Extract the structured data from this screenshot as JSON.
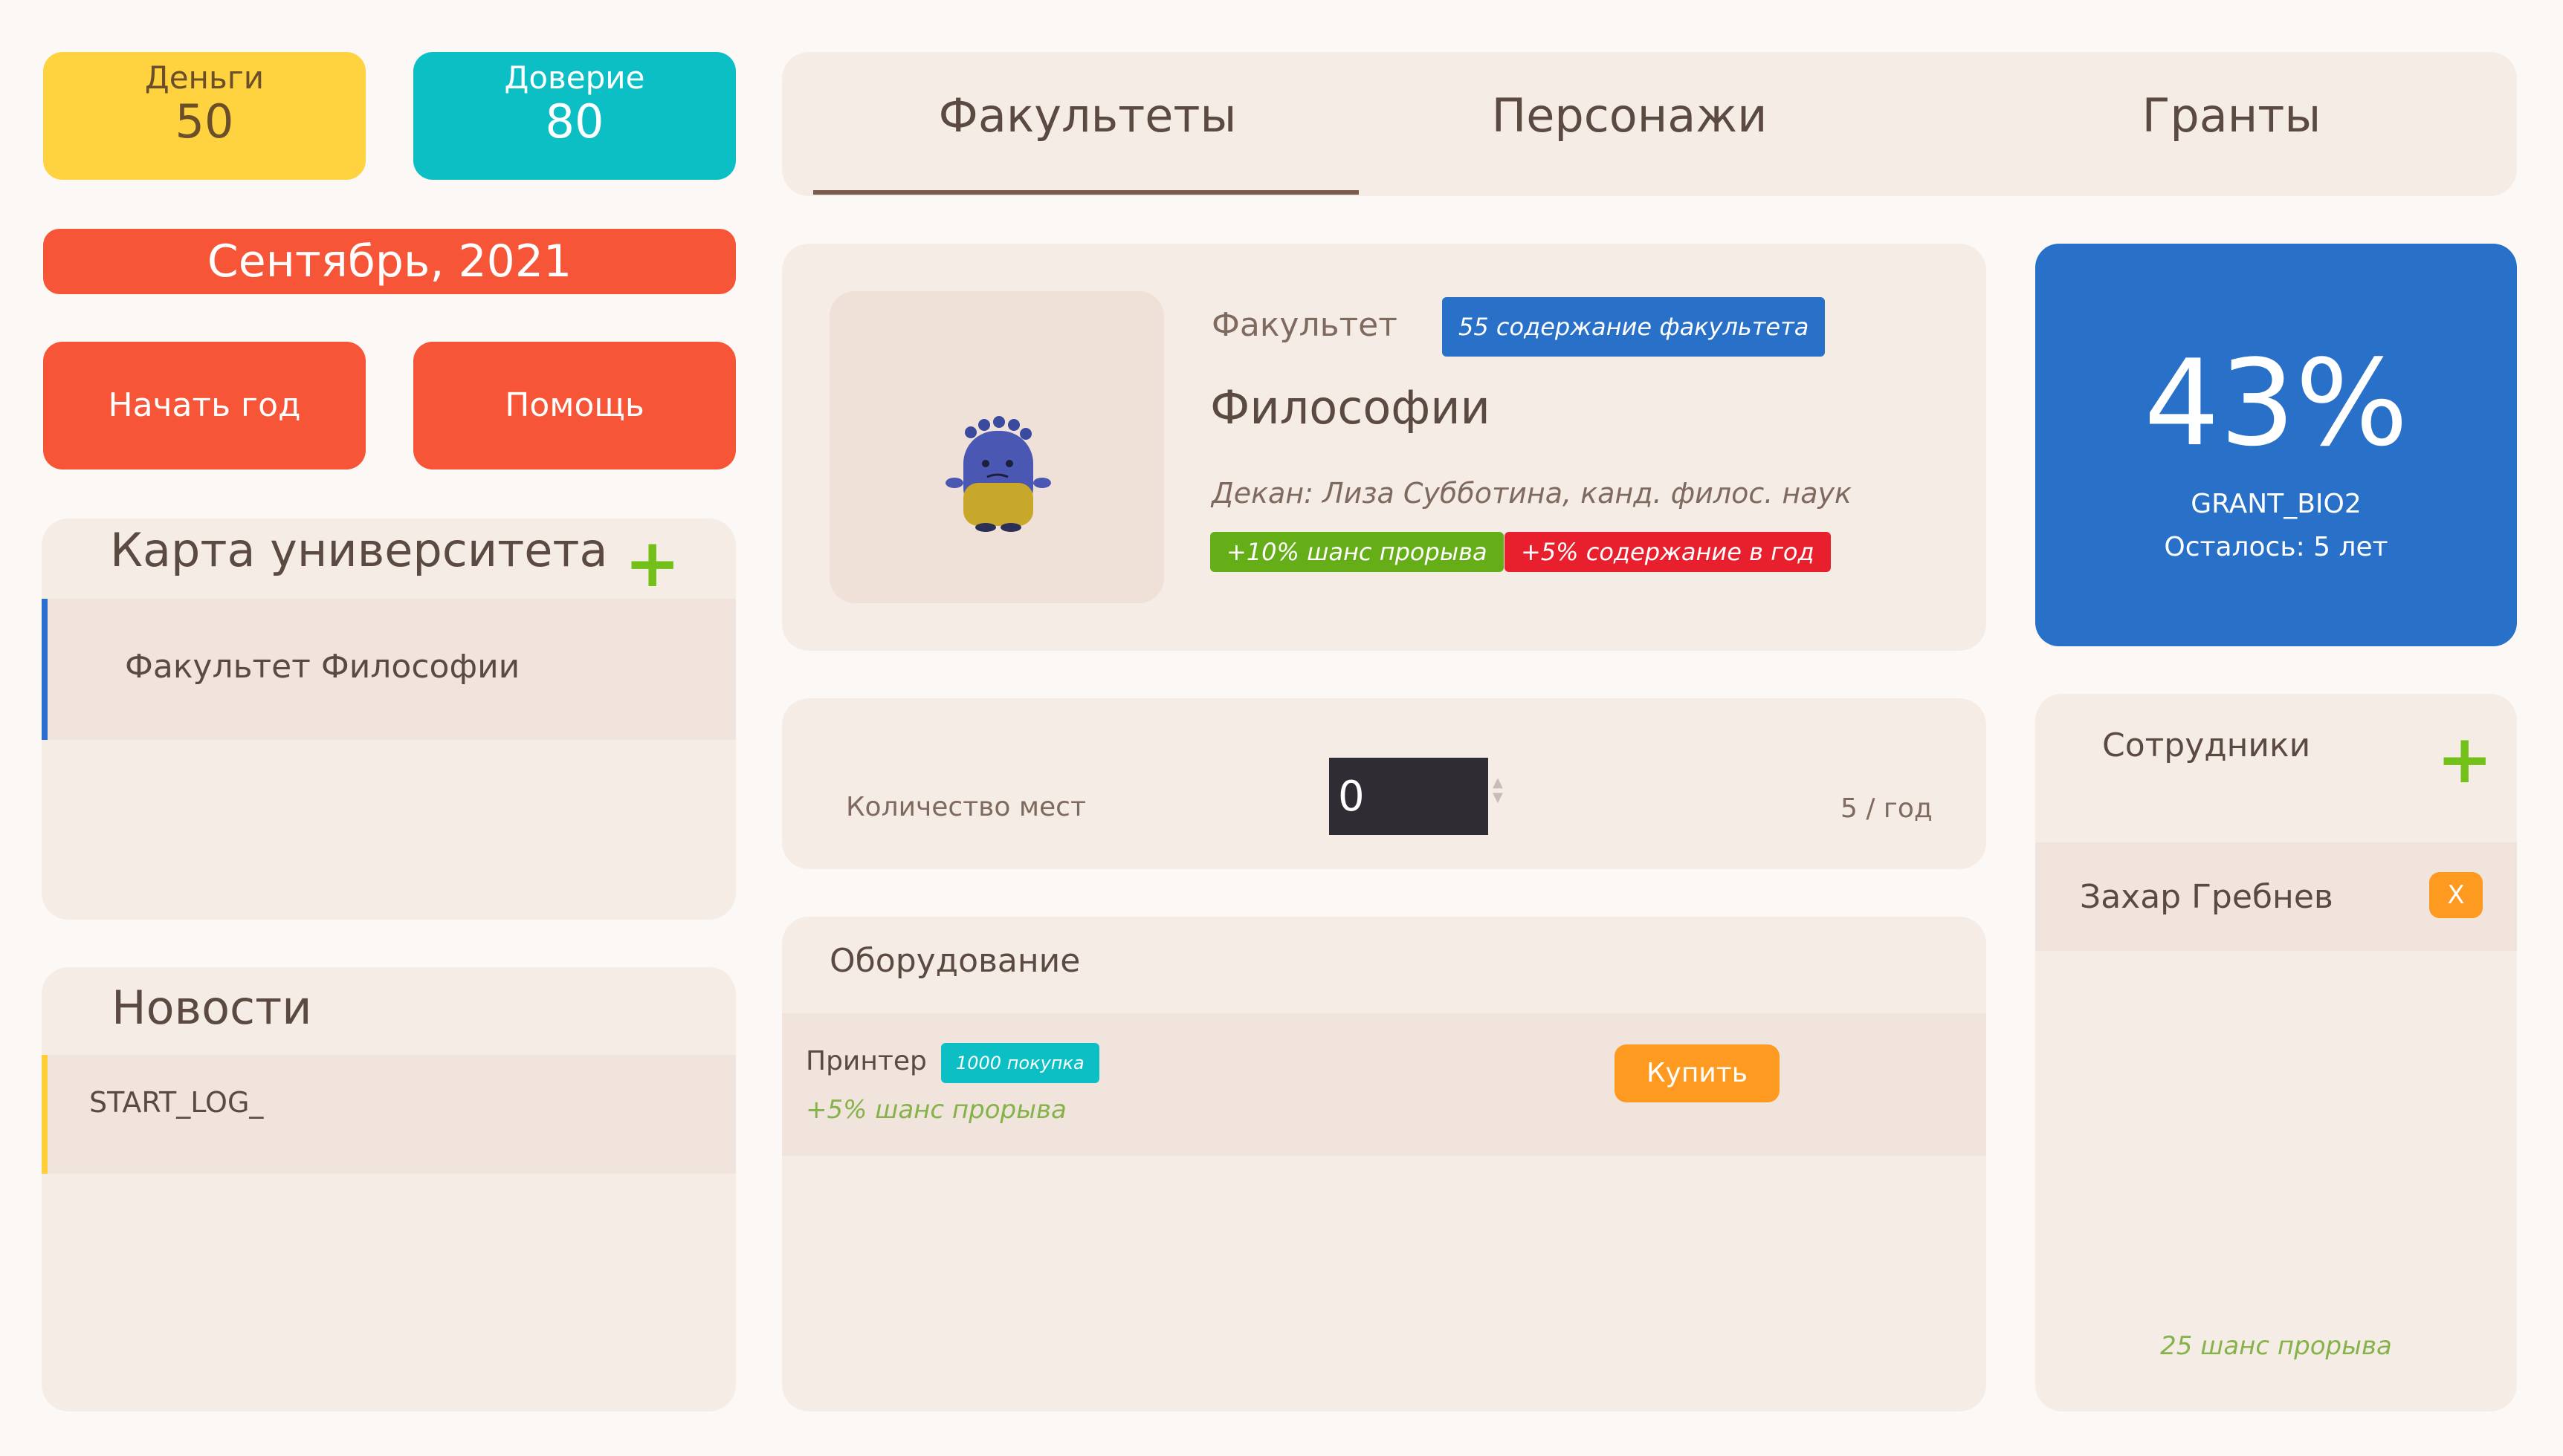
{
  "stats": {
    "money": {
      "label": "Деньги",
      "value": "50"
    },
    "trust": {
      "label": "Доверие",
      "value": "80"
    }
  },
  "date": "Сентябрь, 2021",
  "actions": {
    "start_year": "Начать год",
    "help": "Помощь"
  },
  "map": {
    "title": "Карта университета",
    "add_icon": "plus-icon",
    "items": [
      "Факультет Философии"
    ]
  },
  "news": {
    "title": "Новости",
    "items": [
      "START_LOG_"
    ]
  },
  "tabs": [
    "Факультеты",
    "Персонажи",
    "Гранты"
  ],
  "faculty": {
    "label": "Факультет",
    "upkeep_badge": "55 содержание факультета",
    "name": "Философии",
    "dean": "Декан: Лиза Субботина, канд. филос. наук",
    "tag_good": "+10% шанс прорыва",
    "tag_bad": "+5% содержание в год",
    "avatar_icon": "monster-avatar"
  },
  "grant": {
    "percent": "43%",
    "code": "GRANT_BIO2",
    "remaining": "Осталось: 5 лет"
  },
  "places": {
    "label": "Количество мест",
    "value": "0",
    "per_year": "5 / год"
  },
  "equipment": {
    "title": "Оборудование",
    "items": [
      {
        "name": "Принтер",
        "price": "1000 покупка",
        "effect": "+5% шанс прорыва",
        "buy": "Купить"
      }
    ]
  },
  "staff": {
    "title": "Сотрудники",
    "add_icon": "plus-icon",
    "items": [
      {
        "name": "Захар Гребнев",
        "remove": "X"
      }
    ],
    "footer": "25 шанс прорыва"
  },
  "colors": {
    "accent_red": "#f65537",
    "money_yellow": "#ffd23f",
    "trust_teal": "#0bbfc4",
    "grant_blue": "#2870c8",
    "good_green": "#66ae17",
    "bad_red": "#e8202e",
    "orange": "#ff9a20"
  }
}
